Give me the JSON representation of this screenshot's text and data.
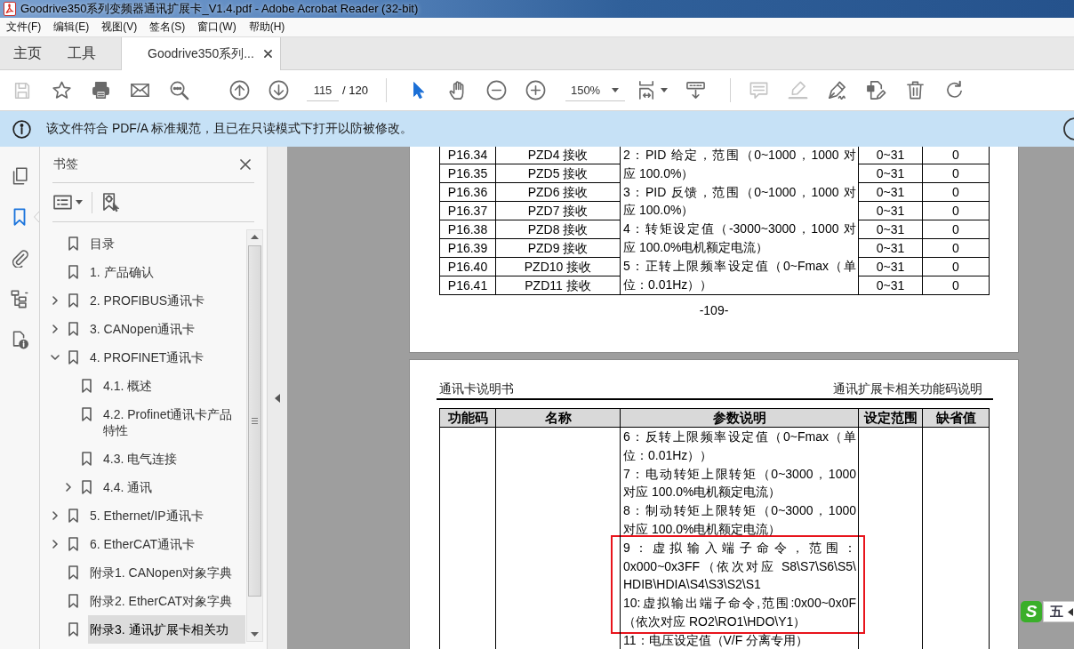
{
  "window": {
    "title": "Goodrive350系列变频器通讯扩展卡_V1.4.pdf - Adobe Acrobat Reader (32-bit)"
  },
  "menu": [
    "文件(F)",
    "编辑(E)",
    "视图(V)",
    "签名(S)",
    "窗口(W)",
    "帮助(H)"
  ],
  "tabs": [
    {
      "label": "主页",
      "selected": false,
      "closable": false
    },
    {
      "label": "工具",
      "selected": false,
      "closable": false
    },
    {
      "label": "Goodrive350系列...",
      "selected": true,
      "closable": true
    }
  ],
  "toolbar": {
    "save": {
      "disabled": true
    },
    "bookmark": {
      "disabled": false
    },
    "print": {
      "disabled": false
    },
    "email": {
      "disabled": false
    },
    "search": {
      "disabled": false
    },
    "previous_page": {
      "disabled": false
    },
    "next_page": {
      "disabled": false
    },
    "page_number": "115",
    "page_total": "/ 120",
    "select": {
      "selected": true
    },
    "hand": {
      "selected": false
    },
    "zoom_out": {
      "disabled": false
    },
    "zoom_in": {
      "disabled": false
    },
    "zoom": "150%",
    "fit_page": {
      "disabled": false
    },
    "scrolling_mode": {
      "disabled": false
    },
    "comment": {
      "disabled": true
    },
    "highlight": {
      "disabled": true
    },
    "sign": {
      "disabled": false
    },
    "edit": {
      "disabled": false
    },
    "delete": {
      "disabled": false
    },
    "rotate": {
      "disabled": false
    }
  },
  "info_bar": {
    "message": "该文件符合 PDF/A 标准规范，且已在只读模式下打开以防被修改。"
  },
  "nav_rail": {
    "pages": {
      "selected": false
    },
    "bookmarks": {
      "selected": true
    },
    "attachments": {
      "selected": false
    },
    "tags": {
      "selected": false
    },
    "properties": {
      "selected": false
    }
  },
  "bookmarks_panel": {
    "title": "书签",
    "items": [
      {
        "label": "目录",
        "selected": false
      },
      {
        "label": "1. 产品确认",
        "selected": false
      },
      {
        "label": "2. PROFIBUS通讯卡",
        "expanded": false,
        "selected": false
      },
      {
        "label": "3. CANopen通讯卡",
        "expanded": false,
        "selected": false
      },
      {
        "label": "4. PROFINET通讯卡",
        "expanded": true,
        "selected": false,
        "children": [
          {
            "label": "4.1. 概述",
            "selected": false
          },
          {
            "label": "4.2. Profinet通讯卡产品特性",
            "selected": false
          },
          {
            "label": "4.3. 电气连接",
            "selected": false
          },
          {
            "label": "4.4. 通讯",
            "expanded": false,
            "selected": false
          }
        ]
      },
      {
        "label": "5. Ethernet/IP通讯卡",
        "expanded": false,
        "selected": false
      },
      {
        "label": "6. EtherCAT通讯卡",
        "expanded": false,
        "selected": false
      },
      {
        "label": "附录1. CANopen对象字典",
        "selected": false
      },
      {
        "label": "附录2. EtherCAT对象字典",
        "selected": false
      },
      {
        "label": "附录3. 通讯扩展卡相关功",
        "selected": true
      }
    ]
  },
  "document": {
    "pages": [
      {
        "table": {
          "rows": [
            {
              "code": "P16.34",
              "name": "PZD4 接收",
              "range": "0~31",
              "default": "0"
            },
            {
              "code": "P16.35",
              "name": "PZD5 接收",
              "range": "0~31",
              "default": "0"
            },
            {
              "code": "P16.36",
              "name": "PZD6 接收",
              "range": "0~31",
              "default": "0"
            },
            {
              "code": "P16.37",
              "name": "PZD7 接收",
              "range": "0~31",
              "default": "0"
            },
            {
              "code": "P16.38",
              "name": "PZD8 接收",
              "range": "0~31",
              "default": "0"
            },
            {
              "code": "P16.39",
              "name": "PZD9 接收",
              "range": "0~31",
              "default": "0"
            },
            {
              "code": "P16.40",
              "name": "PZD10 接收",
              "range": "0~31",
              "default": "0"
            },
            {
              "code": "P16.41",
              "name": "PZD11 接收",
              "range": "0~31",
              "default": "0"
            }
          ],
          "description": [
            {
              "lines": [
                "2：PID 给定，范围（0~1000，1000 对",
                "应 100.0%）"
              ],
              "highlighted": false
            },
            {
              "lines": [
                "3：PID 反馈，范围（0~1000，1000 对",
                "应 100.0%）"
              ],
              "highlighted": false
            },
            {
              "lines": [
                "4：转矩设定值（-3000~3000，1000 对",
                "应 100.0%电机额定电流）"
              ],
              "highlighted": false
            },
            {
              "lines": [
                "5：正转上限频率设定值（0~Fmax（单",
                "位：0.01Hz））"
              ],
              "highlighted": false
            }
          ]
        },
        "footer": "-109-"
      },
      {
        "header_left": "通讯卡说明书",
        "header_right": "通讯扩展卡相关功能码说明",
        "table": {
          "columns": [
            "功能码",
            "名称",
            "参数说明",
            "设定范围",
            "缺省值"
          ],
          "description": [
            {
              "lines": [
                "6：反转上限频率设定值（0~Fmax（单",
                "位：0.01Hz））"
              ],
              "highlighted": false
            },
            {
              "lines": [
                "7：电动转矩上限转矩（0~3000，1000",
                "对应 100.0%电机额定电流）"
              ],
              "highlighted": false
            },
            {
              "lines": [
                "8：制动转矩上限转矩（0~3000，1000",
                "对应 100.0%电机额定电流）"
              ],
              "highlighted": false
            },
            {
              "lines": [
                "9：虚拟输入端子命令，范围：",
                "0x000~0x3FF（依次对应 S8\\S7\\S6\\S5\\",
                "HDIB\\HDIA\\S4\\S3\\S2\\S1"
              ],
              "highlighted": true
            },
            {
              "lines": [
                "10:虚拟输出端子命令,范围:0x00~0x0F",
                "（依次对应 RO2\\RO1\\HDO\\Y1）"
              ],
              "highlighted": true
            },
            {
              "lines": [
                "11：电压设定值（V/F 分离专用）"
              ],
              "highlighted": false
            }
          ]
        }
      }
    ]
  },
  "ime_toolbar": {
    "logo": "S",
    "mode": "五"
  }
}
